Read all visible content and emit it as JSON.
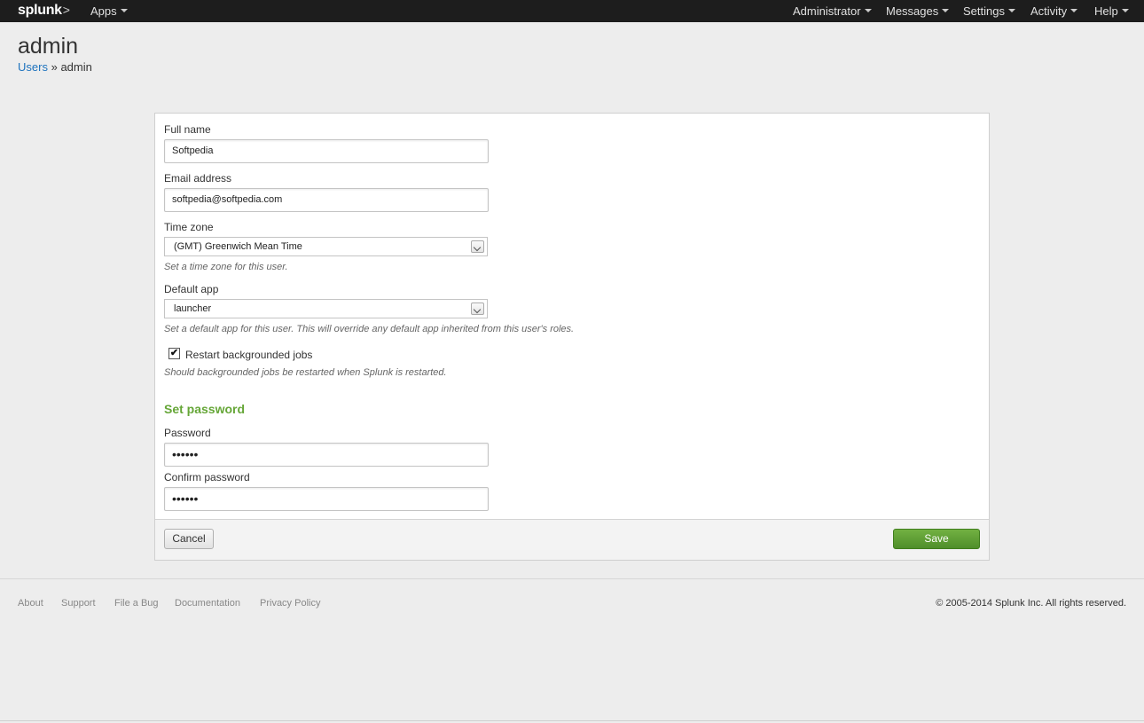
{
  "nav": {
    "logo": "splunk",
    "logo_suffix": ">",
    "apps": "Apps",
    "administrator": "Administrator",
    "messages": "Messages",
    "settings": "Settings",
    "activity": "Activity",
    "help": "Help"
  },
  "header": {
    "title": "admin",
    "breadcrumb_link": "Users",
    "breadcrumb_sep": "»",
    "breadcrumb_current": "admin"
  },
  "form": {
    "full_name_label": "Full name",
    "full_name_value": "Softpedia",
    "email_label": "Email address",
    "email_value": "softpedia@softpedia.com",
    "timezone_label": "Time zone",
    "timezone_value": "(GMT) Greenwich Mean Time",
    "timezone_help": "Set a time zone for this user.",
    "default_app_label": "Default app",
    "default_app_value": "launcher",
    "default_app_help": "Set a default app for this user. This will override any default app inherited from this user's roles.",
    "restart_jobs_label": "Restart backgrounded jobs",
    "restart_jobs_checked": true,
    "restart_jobs_mark": "✔",
    "restart_jobs_help": "Should backgrounded jobs be restarted when Splunk is restarted.",
    "set_password_title": "Set password",
    "password_label": "Password",
    "password_value": "••••••",
    "confirm_password_label": "Confirm password",
    "confirm_password_value": "••••••"
  },
  "actions": {
    "cancel": "Cancel",
    "save": "Save"
  },
  "footer": {
    "links": [
      "About",
      "Support",
      "File a Bug",
      "Documentation",
      "Privacy Policy"
    ],
    "copyright": "© 2005-2014 Splunk Inc. All rights reserved."
  },
  "colors": {
    "topbar": "#1d1d1d",
    "link": "#1e73be",
    "accent_green": "#65a637",
    "save_button": "#5c9c33"
  }
}
